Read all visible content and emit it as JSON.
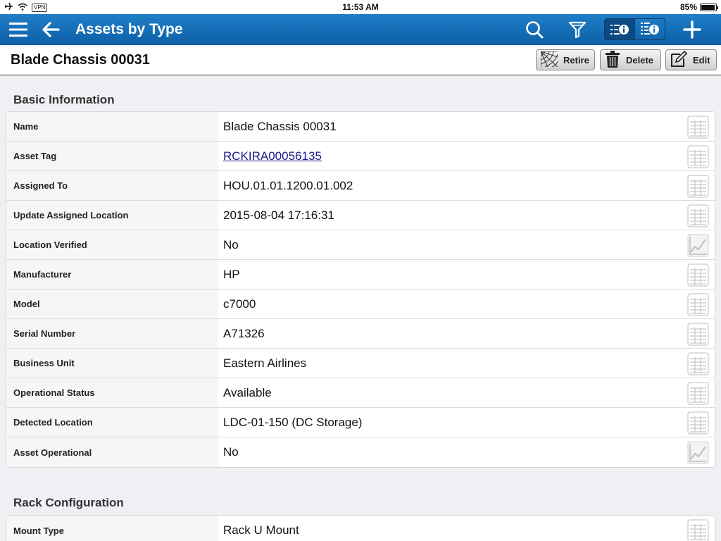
{
  "status_bar": {
    "vpn": "VPN",
    "time": "11:53 AM",
    "battery": "85%",
    "battery_level": 0.85
  },
  "nav": {
    "title": "Assets by Type",
    "icons": [
      "menu-icon",
      "back-arrow-icon",
      "search-icon",
      "filter-icon",
      "list-info-icon",
      "detail-info-icon",
      "add-icon"
    ]
  },
  "record": {
    "title": "Blade Chassis 00031",
    "actions": {
      "retire": "Retire",
      "delete": "Delete",
      "edit": "Edit"
    }
  },
  "basic_info": {
    "title": "Basic Information",
    "rows": [
      {
        "label": "Name",
        "value": "Blade Chassis 00031",
        "icon": "grid"
      },
      {
        "label": "Asset Tag",
        "value": "RCKIRA00056135",
        "icon": "grid"
      },
      {
        "label": "Assigned To",
        "value": "HOU.01.01.1200.01.002",
        "icon": "grid"
      },
      {
        "label": "Update Assigned Location",
        "value": "2015-08-04 17:16:31",
        "icon": "grid"
      },
      {
        "label": "Location Verified",
        "value": "No",
        "icon": "chart"
      },
      {
        "label": "Manufacturer",
        "value": "HP",
        "icon": "grid"
      },
      {
        "label": "Model",
        "value": "c7000",
        "icon": "grid"
      },
      {
        "label": "Serial Number",
        "value": "A71326",
        "icon": "grid"
      },
      {
        "label": "Business Unit",
        "value": "Eastern Airlines",
        "icon": "grid"
      },
      {
        "label": "Operational Status",
        "value": "Available",
        "icon": "grid"
      },
      {
        "label": "Detected Location",
        "value": "LDC-01-150 (DC Storage)",
        "icon": "grid"
      },
      {
        "label": "Asset Operational",
        "value": "No",
        "icon": "chart"
      }
    ]
  },
  "rack_config": {
    "title": "Rack Configuration",
    "rows": [
      {
        "label": "Mount Type",
        "value": "Rack U Mount",
        "icon": "grid"
      }
    ]
  },
  "colors": {
    "nav_top": "#1f7fc8",
    "nav_bottom": "#0d5fa6",
    "link": "#1a1a8c"
  }
}
